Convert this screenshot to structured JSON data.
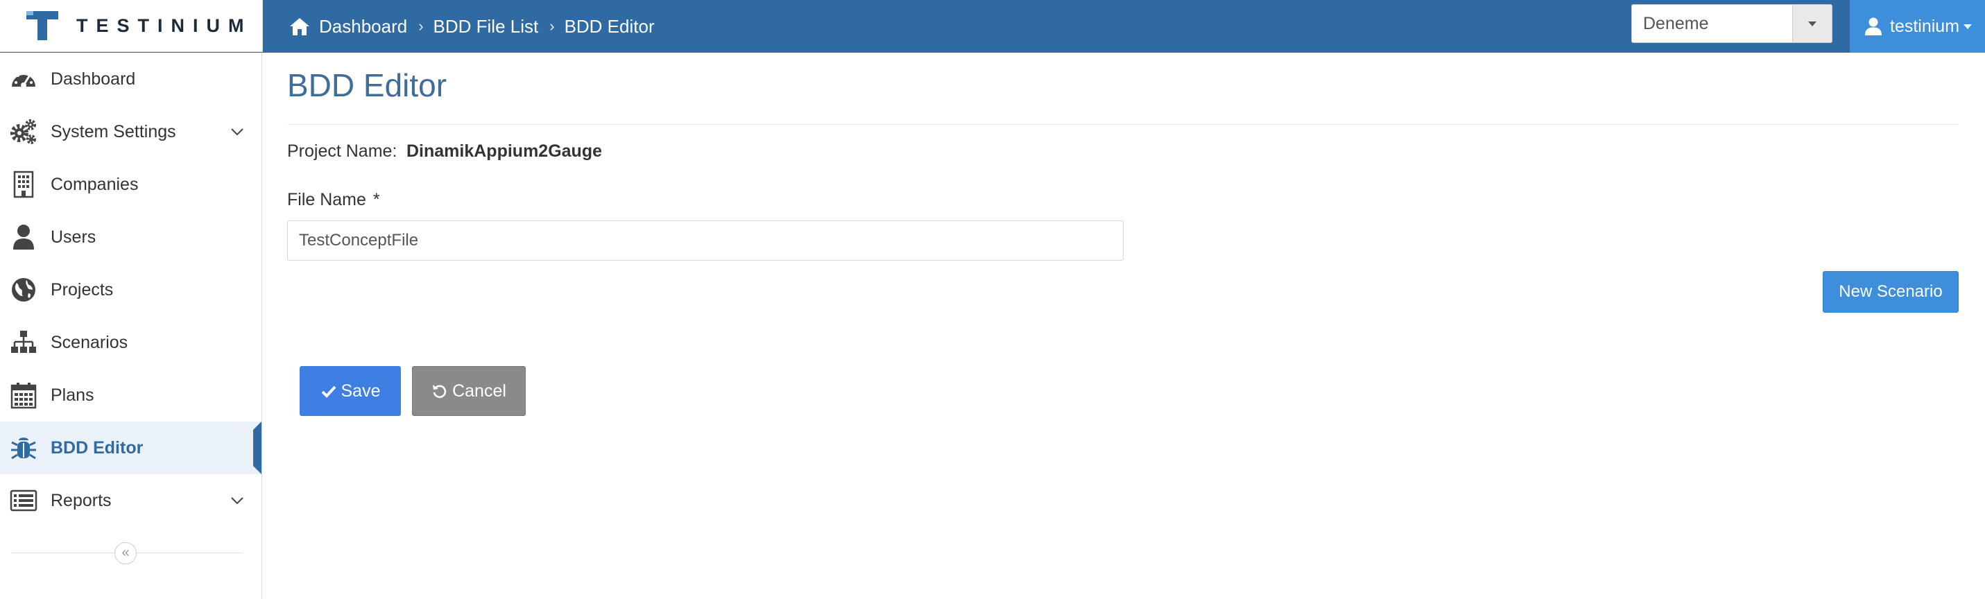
{
  "brand": {
    "name": "TESTINIUM"
  },
  "breadcrumb": [
    {
      "label": "Dashboard",
      "icon": "home-icon"
    },
    {
      "label": "BDD File List"
    },
    {
      "label": "BDD Editor"
    }
  ],
  "project_select": {
    "value": "Deneme"
  },
  "user_menu": {
    "label": "testinium",
    "icon": "user-icon"
  },
  "sidebar": {
    "items": [
      {
        "label": "Dashboard",
        "icon": "dashboard-icon"
      },
      {
        "label": "System Settings",
        "icon": "gears-icon",
        "expandable": true
      },
      {
        "label": "Companies",
        "icon": "building-icon"
      },
      {
        "label": "Users",
        "icon": "user-icon"
      },
      {
        "label": "Projects",
        "icon": "globe-icon"
      },
      {
        "label": "Scenarios",
        "icon": "sitemap-icon"
      },
      {
        "label": "Plans",
        "icon": "calendar-icon"
      },
      {
        "label": "BDD Editor",
        "icon": "bug-icon",
        "active": true
      },
      {
        "label": "Reports",
        "icon": "list-icon",
        "expandable": true
      }
    ],
    "collapse_icon": "double-chevron-left-icon"
  },
  "main": {
    "title": "BDD Editor",
    "project_label": "Project Name:",
    "project_value": "DinamikAppium2Gauge",
    "file_name_label": "File Name",
    "file_name_required": "*",
    "file_name_value": "TestConceptFile",
    "new_scenario_label": "New Scenario",
    "save_label": "Save",
    "cancel_label": "Cancel"
  },
  "colors": {
    "topbar": "#2f6aa2",
    "user_button": "#3d8fdc",
    "primary": "#3d7fe3",
    "secondary": "#8a8a8a",
    "active_text": "#2f6aa2",
    "title": "#3f6c98"
  }
}
